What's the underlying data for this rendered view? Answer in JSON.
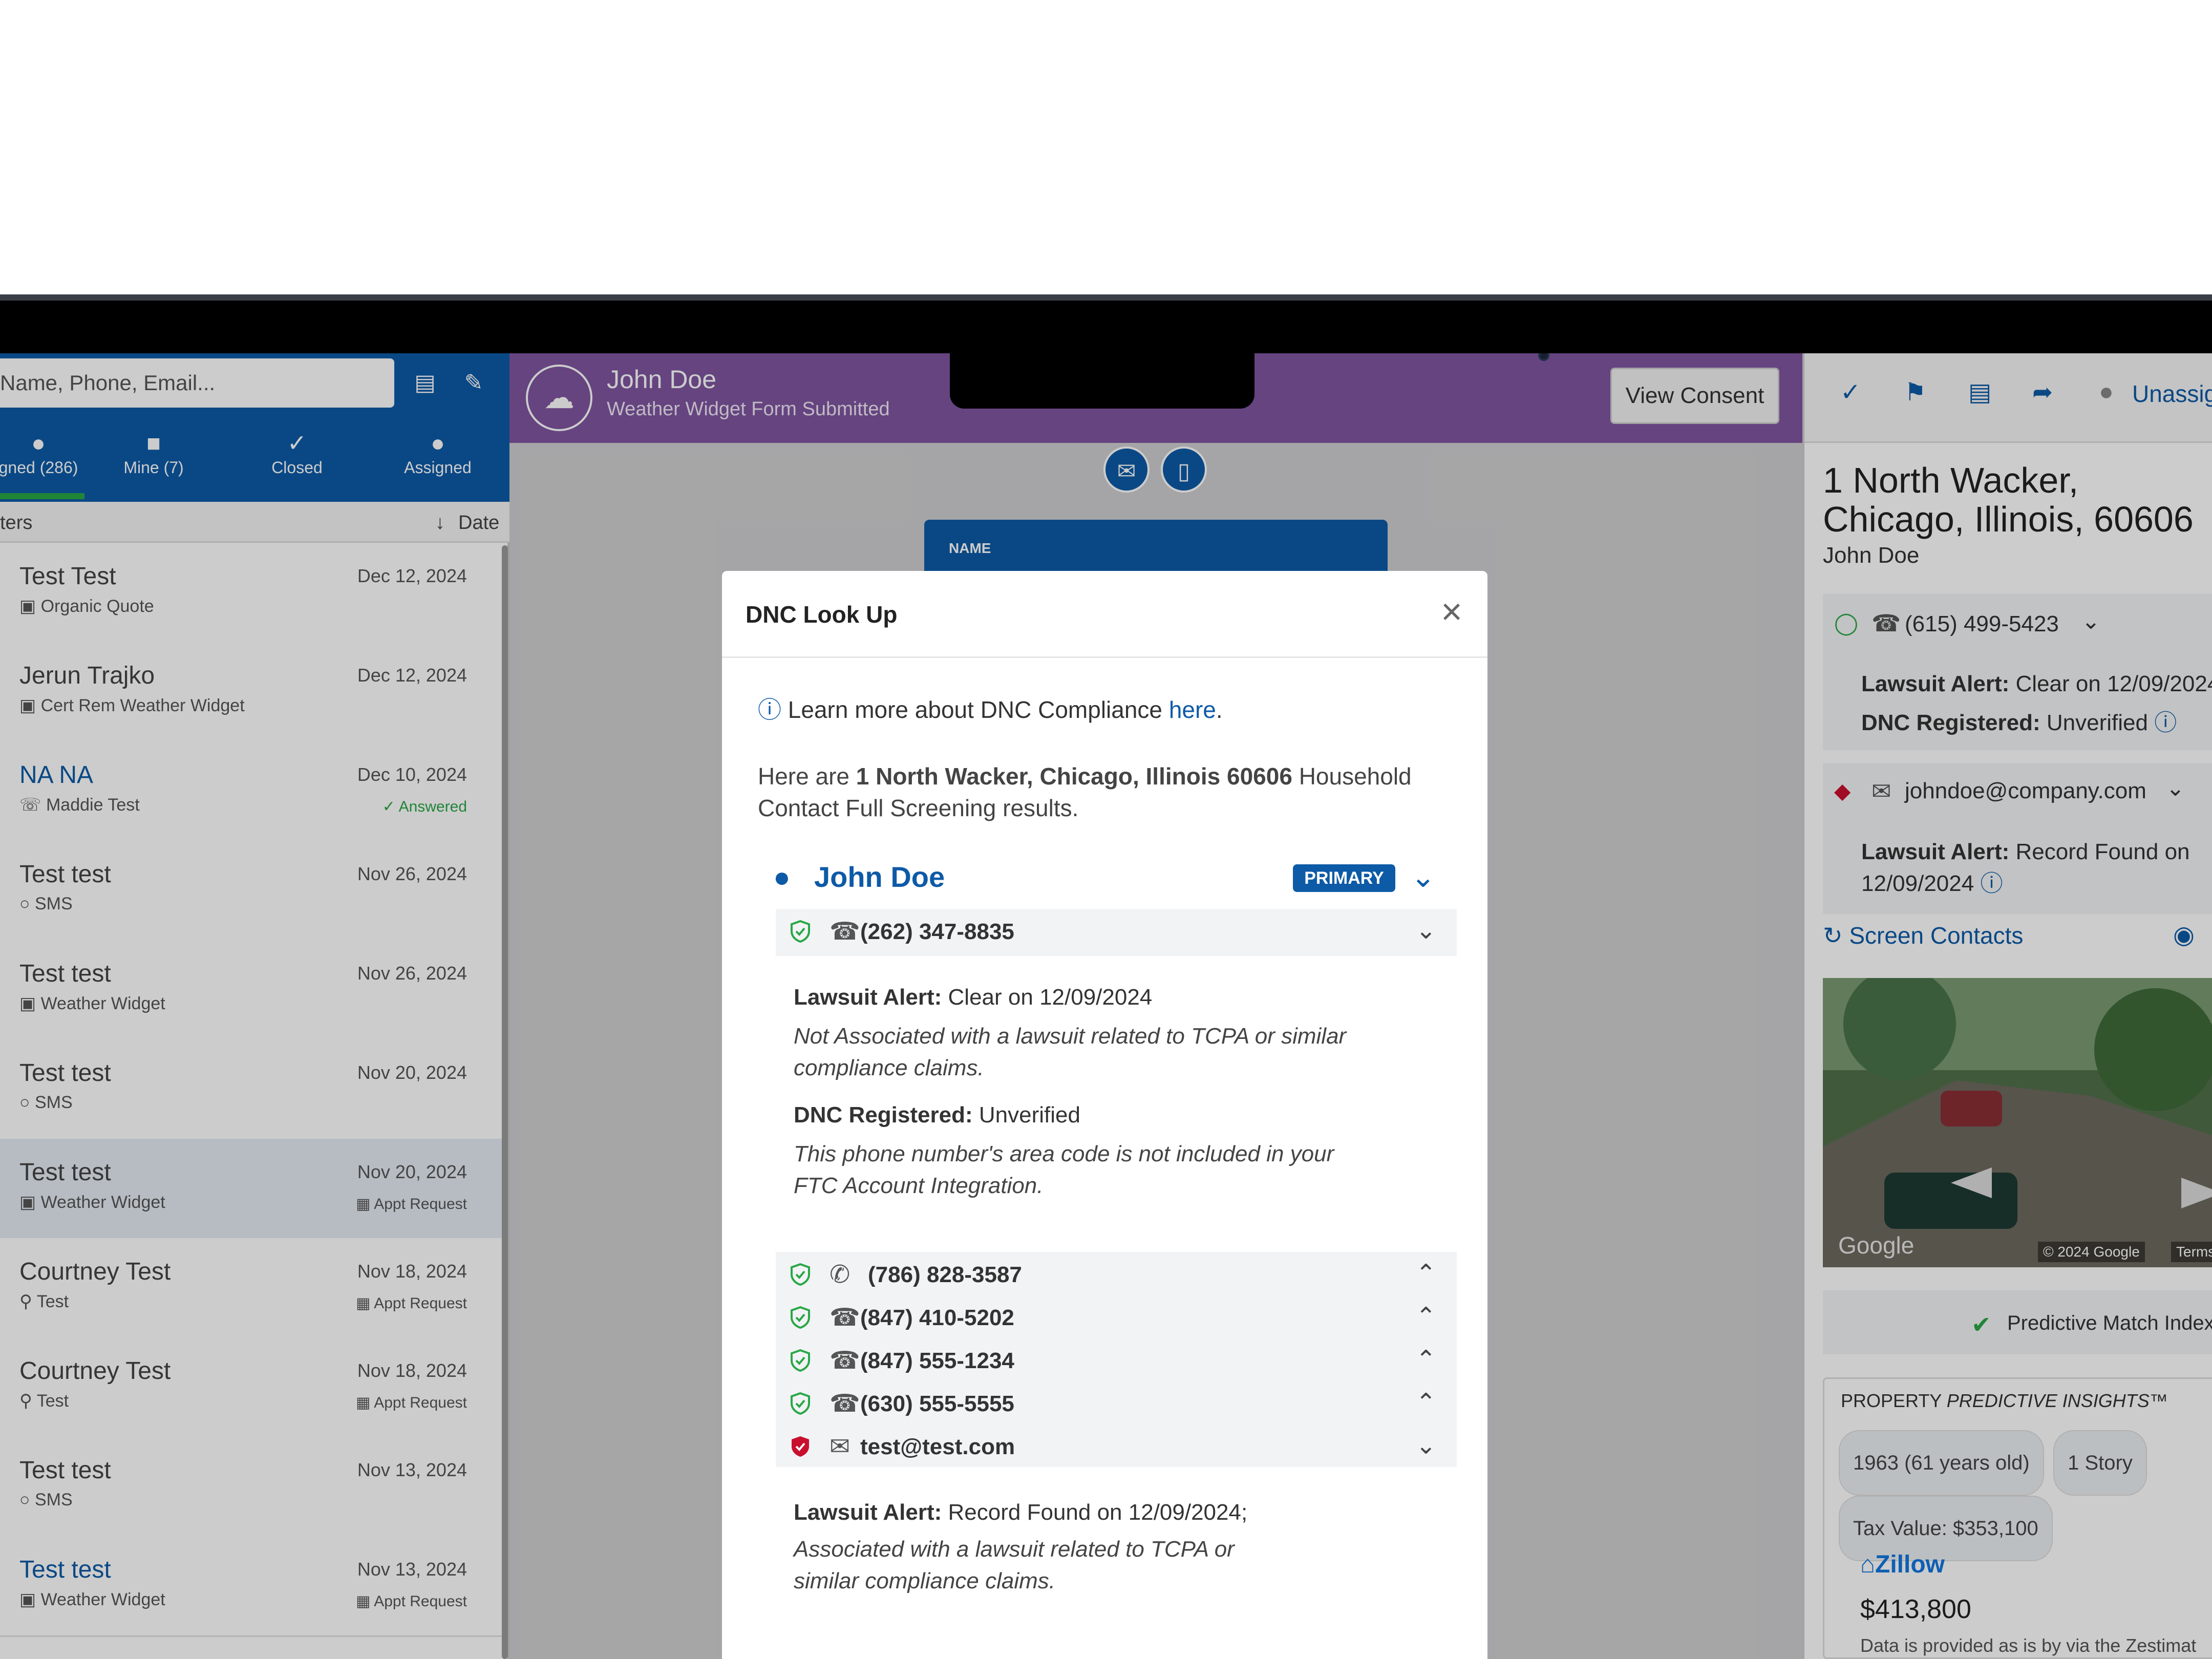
{
  "left": {
    "search_placeholder": "Name, Phone, Email...",
    "tabs": [
      {
        "label": "gned (286)"
      },
      {
        "label": "Mine (7)"
      },
      {
        "label": "Closed"
      },
      {
        "label": "Assigned"
      }
    ],
    "filter_label": "ters",
    "sort_label": "Date",
    "rows": [
      {
        "name": "Test Test",
        "sub": "Organic Quote",
        "date": "Dec 12, 2024",
        "tag": ""
      },
      {
        "name": "Jerun Trajko",
        "sub": "Cert Rem Weather Widget",
        "date": "Dec 12, 2024",
        "tag": ""
      },
      {
        "name": "NA NA",
        "sub": "Maddie Test",
        "date": "Dec 10, 2024",
        "tag": "Answered"
      },
      {
        "name": "Test test",
        "sub": "SMS",
        "date": "Nov 26, 2024",
        "tag": ""
      },
      {
        "name": "Test test",
        "sub": "Weather Widget",
        "date": "Nov 26, 2024",
        "tag": ""
      },
      {
        "name": "Test test",
        "sub": "SMS",
        "date": "Nov 20, 2024",
        "tag": ""
      },
      {
        "name": "Test test",
        "sub": "Weather Widget",
        "date": "Nov 20, 2024",
        "tag": "Appt Request"
      },
      {
        "name": "Courtney Test",
        "sub": "Test",
        "date": "Nov 18, 2024",
        "tag": "Appt Request"
      },
      {
        "name": "Courtney Test",
        "sub": "Test",
        "date": "Nov 18, 2024",
        "tag": "Appt Request"
      },
      {
        "name": "Test test",
        "sub": "SMS",
        "date": "Nov 13, 2024",
        "tag": ""
      },
      {
        "name": "Test test",
        "sub": "Weather Widget",
        "date": "Nov 13, 2024",
        "tag": "Appt Request"
      }
    ]
  },
  "center": {
    "contact_name": "John Doe",
    "contact_sub": "Weather Widget Form Submitted",
    "view_consent": "View Consent",
    "card_label": "NAME"
  },
  "right": {
    "assign_label": "Unassig",
    "address_line1": "1 North Wacker,",
    "address_line2": "Chicago, Illinois, 60606",
    "name": "John Doe",
    "phone": "(615) 499-5423",
    "phone_lawsuit_label": "Lawsuit Alert:",
    "phone_lawsuit_value": "Clear on 12/09/2024",
    "phone_dnc_label": "DNC Registered:",
    "phone_dnc_value": "Unverified",
    "email": "johndoe@company.com",
    "email_lawsuit_label": "Lawsuit Alert:",
    "email_lawsuit_value": "Record Found on",
    "email_lawsuit_date": "12/09/2024",
    "screen_contacts": "Screen Contacts",
    "map_google": "Google",
    "map_copyright": "© 2024 Google",
    "map_terms": "Terms",
    "pmi_label": "Predictive Match Index",
    "insights_prefix": "PROPERTY",
    "insights_title": "PREDICTIVE INSIGHTS™",
    "chips": [
      "1963 (61 years old)",
      "1 Story",
      "Tax Value: $353,100"
    ],
    "zillow": "Zillow",
    "price": "$413,800",
    "zestimate_note": "Data is provided as is by via the Zestimat"
  },
  "modal": {
    "title": "DNC Look Up",
    "info_text": "Learn more about DNC Compliance",
    "info_link": "here",
    "info_period": ".",
    "intro_prefix": "Here are",
    "intro_address": "1 North Wacker, Chicago, Illinois 60606",
    "intro_suffix": "Household Contact Full Screening results.",
    "person": "John Doe",
    "primary_badge": "PRIMARY",
    "items": [
      {
        "value": "(262) 347-8835",
        "status": "clear"
      },
      {
        "value": "(786) 828-3587",
        "status": "clear"
      },
      {
        "value": "(847) 410-5202",
        "status": "clear"
      },
      {
        "value": "(847) 555-1234",
        "status": "clear"
      },
      {
        "value": "(630) 555-5555",
        "status": "clear"
      },
      {
        "value": "test@test.com",
        "status": "flagged"
      }
    ],
    "detail1": {
      "lawsuit_label": "Lawsuit Alert:",
      "lawsuit_value": "Clear on 12/09/2024",
      "lawsuit_note": "Not Associated with a lawsuit related to TCPA or similar compliance claims.",
      "dnc_label": "DNC Registered:",
      "dnc_value": "Unverified",
      "dnc_note": "This phone number's area code is not included in your FTC Account Integration."
    },
    "detail2": {
      "lawsuit_label": "Lawsuit Alert:",
      "lawsuit_value": "Record Found on 12/09/2024;",
      "lawsuit_note": "Associated with a lawsuit related to TCPA or similar compliance claims."
    }
  },
  "colors": {
    "brand_blue": "#0d5aa7",
    "header_purple": "#7f55a0",
    "clear_green": "#28a745",
    "flag_red": "#c8102e"
  }
}
